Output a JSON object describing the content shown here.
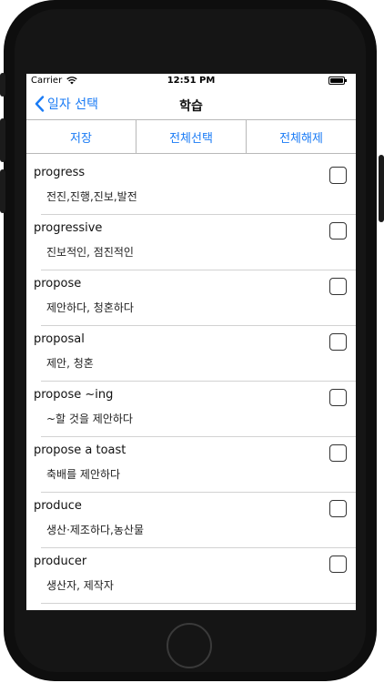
{
  "status": {
    "carrier": "Carrier",
    "time": "12:51 PM"
  },
  "nav": {
    "back_label": "일자 선택",
    "title": "학습"
  },
  "toolbar": {
    "save": "저장",
    "select_all": "전체선택",
    "deselect_all": "전체해제"
  },
  "words": [
    {
      "word": "progress",
      "meaning": "전진,진행,진보,발전",
      "checked": false
    },
    {
      "word": "progressive",
      "meaning": "진보적인, 점진적인",
      "checked": false
    },
    {
      "word": "propose",
      "meaning": "제안하다, 청혼하다",
      "checked": false
    },
    {
      "word": "proposal",
      "meaning": "제안, 청혼",
      "checked": false
    },
    {
      "word": "propose ~ing",
      "meaning": "~할 것을 제안하다",
      "checked": false
    },
    {
      "word": "propose a toast",
      "meaning": "축배를 제안하다",
      "checked": false
    },
    {
      "word": "produce",
      "meaning": "생산·제조하다,농산물",
      "checked": false
    },
    {
      "word": "producer",
      "meaning": "생산자, 제작자",
      "checked": false
    }
  ],
  "colors": {
    "accent": "#1a7bf5",
    "separator": "#d2d2d2",
    "phone_body": "#0e0e0e"
  }
}
